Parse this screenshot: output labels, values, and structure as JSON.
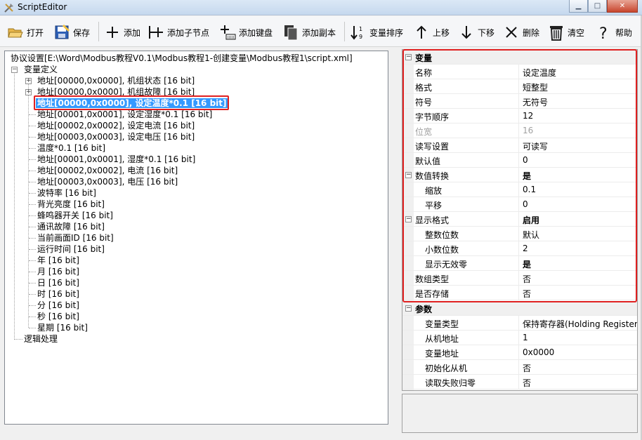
{
  "window": {
    "title": "ScriptEditor"
  },
  "toolbar": {
    "open": "打开",
    "save": "保存",
    "add": "添加",
    "add_child": "添加子节点",
    "add_keyboard": "添加键盘",
    "add_copy": "添加副本",
    "sort_vars": "变量排序",
    "move_up": "上移",
    "move_down": "下移",
    "delete": "删除",
    "clear": "清空",
    "help": "帮助"
  },
  "tree": {
    "root": "协议设置[E:\\Word\\Modbus教程V0.1\\Modbus教程1-创建变量\\Modbus教程1\\script.xml]",
    "var_group": "变量定义",
    "items": [
      "地址[00000,0x0000], 机组状态 [16 bit]",
      "地址[00000,0x0000], 机组故障 [16 bit]",
      "地址[00000,0x0000], 设定温度*0.1 [16 bit]",
      "地址[00001,0x0001], 设定湿度*0.1 [16 bit]",
      "地址[00002,0x0002], 设定电流 [16 bit]",
      "地址[00003,0x0003], 设定电压 [16 bit]",
      "温度*0.1 [16 bit]",
      "地址[00001,0x0001], 湿度*0.1 [16 bit]",
      "地址[00002,0x0002], 电流 [16 bit]",
      "地址[00003,0x0003], 电压 [16 bit]",
      "波特率 [16 bit]",
      "背光亮度 [16 bit]",
      "蜂鸣器开关 [16 bit]",
      "通讯故障 [16 bit]",
      "当前画面ID [16 bit]",
      "运行时间 [16 bit]",
      "年 [16 bit]",
      "月 [16 bit]",
      "日 [16 bit]",
      "时 [16 bit]",
      "分 [16 bit]",
      "秒 [16 bit]",
      "星期 [16 bit]"
    ],
    "logic": "逻辑处理"
  },
  "props": {
    "cat_variable": "变量",
    "name_label": "名称",
    "name_value": "设定温度",
    "format_label": "格式",
    "format_value": "短整型",
    "sign_label": "符号",
    "sign_value": "无符号",
    "byteorder_label": "字节顺序",
    "byteorder_value": "12",
    "bitwidth_label": "位宽",
    "bitwidth_value": "16",
    "rw_label": "读写设置",
    "rw_value": "可读写",
    "default_label": "默认值",
    "default_value": "0",
    "conv_label": "数值转换",
    "conv_value": "是",
    "scale_label": "缩放",
    "scale_value": "0.1",
    "offset_label": "平移",
    "offset_value": "0",
    "disp_label": "显示格式",
    "disp_value": "启用",
    "intdigits_label": "整数位数",
    "intdigits_value": "默认",
    "decdigits_label": "小数位数",
    "decdigits_value": "2",
    "zeros_label": "显示无效零",
    "zeros_value": "是",
    "array_label": "数组类型",
    "array_value": "否",
    "store_label": "是否存储",
    "store_value": "否",
    "cat_params": "参数",
    "vartype_label": "变量类型",
    "vartype_value": "保持寄存器(Holding Register",
    "slave_label": "从机地址",
    "slave_value": "1",
    "varaddr_label": "变量地址",
    "varaddr_value": "0x0000",
    "init_label": "初始化从机",
    "init_value": "否",
    "readfail_label": "读取失败归零",
    "readfail_value": "否"
  },
  "colors": {
    "selection": "#3399ff",
    "highlight_frame": "#e02020"
  }
}
